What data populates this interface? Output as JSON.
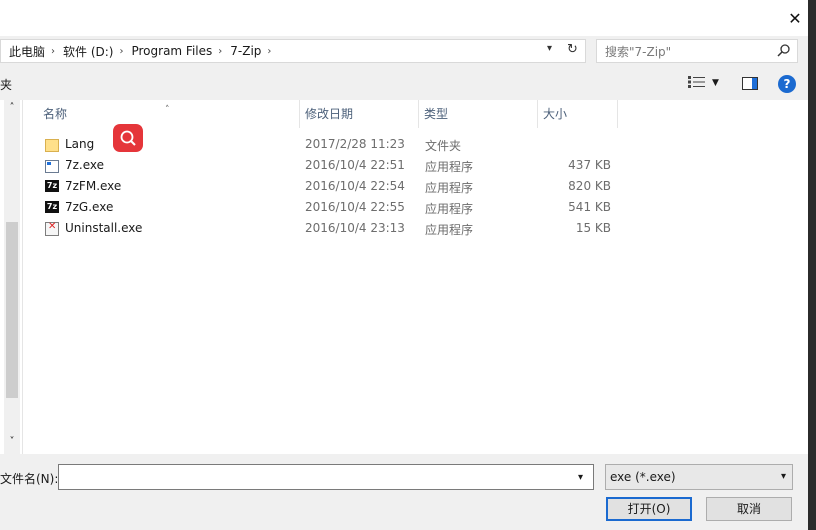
{
  "window": {
    "close_symbol": "✕"
  },
  "address_bar": {
    "breadcrumbs": [
      "此电脑",
      "软件 (D:)",
      "Program Files",
      "7-Zip"
    ],
    "separator": "›"
  },
  "search": {
    "placeholder": "搜索\"7-Zip\""
  },
  "toolbar": {
    "left_partial": "夹",
    "help_label": "?"
  },
  "columns": {
    "name": "名称",
    "date": "修改日期",
    "type": "类型",
    "size": "大小"
  },
  "files": [
    {
      "name": "Lang",
      "date": "2017/2/28 11:23",
      "type": "文件夹",
      "size": "",
      "icon": "folder-icon"
    },
    {
      "name": "7z.exe",
      "date": "2016/10/4 22:51",
      "type": "应用程序",
      "size": "437 KB",
      "icon": "app-icon"
    },
    {
      "name": "7zFM.exe",
      "date": "2016/10/4 22:54",
      "type": "应用程序",
      "size": "820 KB",
      "icon": "7zip-icon"
    },
    {
      "name": "7zG.exe",
      "date": "2016/10/4 22:55",
      "type": "应用程序",
      "size": "541 KB",
      "icon": "7zip-icon"
    },
    {
      "name": "Uninstall.exe",
      "date": "2016/10/4 23:13",
      "type": "应用程序",
      "size": "15 KB",
      "icon": "uninstall-icon"
    }
  ],
  "bottom": {
    "filename_label": "文件名(N):",
    "filename_value": "",
    "filetype_value": "exe (*.exe)",
    "open_label": "打开(O)",
    "cancel_label": "取消"
  },
  "colors": {
    "accent": "#1b6ad0",
    "red_overlay": "#e5353a"
  }
}
